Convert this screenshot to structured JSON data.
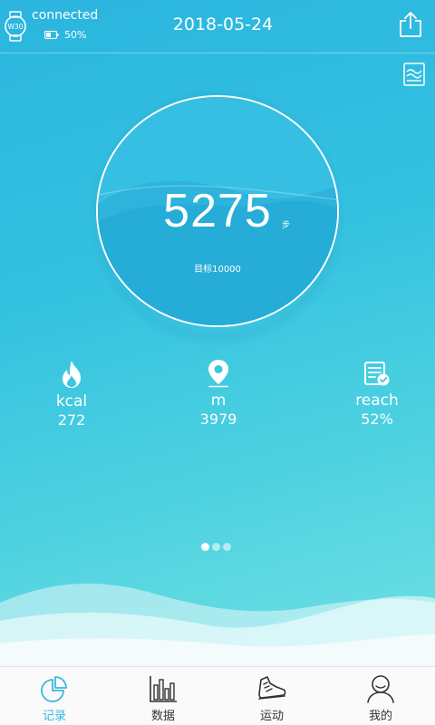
{
  "header": {
    "device_name": "W30",
    "connection_status": "connected",
    "battery_percent": "50%",
    "date": "2018-05-24"
  },
  "summary": {
    "steps": "5275",
    "steps_unit": "步",
    "goal": "目标10000"
  },
  "stats": [
    {
      "icon": "flame-icon",
      "label": "kcal",
      "value": "272"
    },
    {
      "icon": "location-pin-icon",
      "label": "m",
      "value": "3979"
    },
    {
      "icon": "checklist-icon",
      "label": "reach",
      "value": "52%"
    }
  ],
  "pager": {
    "active_index": 0,
    "count": 3
  },
  "tabs": [
    {
      "label": "记录",
      "icon": "pie-chart-icon",
      "active": true
    },
    {
      "label": "数据",
      "icon": "bar-chart-icon",
      "active": false
    },
    {
      "label": "运动",
      "icon": "sneaker-icon",
      "active": false
    },
    {
      "label": "我的",
      "icon": "person-icon",
      "active": false
    }
  ],
  "colors": {
    "accent": "#39b8de",
    "background_top": "#2bb5df",
    "background_bottom": "#6fe0e3"
  }
}
